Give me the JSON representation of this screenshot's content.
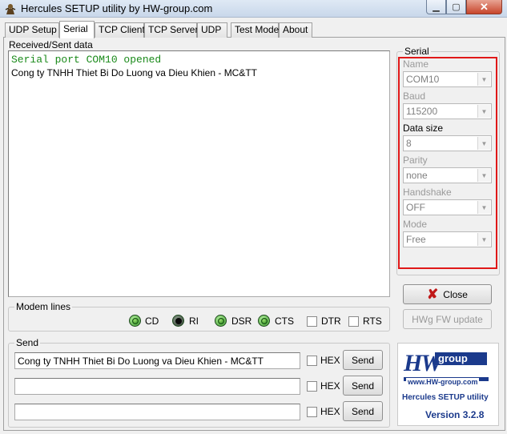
{
  "window": {
    "title": "Hercules SETUP utility by HW-group.com",
    "minimize_glyph": "▁",
    "maximize_glyph": "▢",
    "close_glyph": "✕"
  },
  "tabs": [
    {
      "label": "UDP Setup",
      "active": false
    },
    {
      "label": "Serial",
      "active": true
    },
    {
      "label": "TCP Client",
      "active": false
    },
    {
      "label": "TCP Server",
      "active": false
    },
    {
      "label": "UDP",
      "active": false
    },
    {
      "label": "Test Mode",
      "active": false
    },
    {
      "label": "About",
      "active": false
    }
  ],
  "received": {
    "label": "Received/Sent data",
    "lines": [
      "Serial port COM10 opened",
      "Cong ty TNHH Thiet Bi Do Luong va Dieu Khien - MC&TT"
    ]
  },
  "serial": {
    "group_label": "Serial",
    "highlight_color": "#e01818",
    "fields": [
      {
        "label": "Name",
        "value": "COM10",
        "label_enabled": false
      },
      {
        "label": "Baud",
        "value": "115200",
        "label_enabled": false
      },
      {
        "label": "Data size",
        "value": "8",
        "label_enabled": true
      },
      {
        "label": "Parity",
        "value": "none",
        "label_enabled": false
      },
      {
        "label": "Handshake",
        "value": "OFF",
        "label_enabled": false
      },
      {
        "label": "Mode",
        "value": "Free",
        "label_enabled": false
      }
    ],
    "close_label": "Close",
    "close_icon": "x-icon",
    "fw_update_label": "HWg FW update"
  },
  "modem": {
    "group_label": "Modem lines",
    "leds": [
      {
        "label": "CD",
        "state": "on"
      },
      {
        "label": "RI",
        "state": "off"
      },
      {
        "label": "DSR",
        "state": "on"
      },
      {
        "label": "CTS",
        "state": "on"
      }
    ],
    "checkboxes": [
      {
        "label": "DTR",
        "checked": false
      },
      {
        "label": "RTS",
        "checked": false
      }
    ]
  },
  "send": {
    "group_label": "Send",
    "rows": [
      {
        "value": "Cong ty TNHH Thiet Bi Do Luong va Dieu Khien - MC&TT",
        "hex_label": "HEX",
        "hex_checked": false,
        "button_label": "Send"
      },
      {
        "value": "",
        "hex_label": "HEX",
        "hex_checked": false,
        "button_label": "Send"
      },
      {
        "value": "",
        "hex_label": "HEX",
        "hex_checked": false,
        "button_label": "Send"
      }
    ]
  },
  "logo": {
    "hw": "HW",
    "group": "group",
    "url": "www.HW-group.com",
    "product": "Hercules SETUP utility",
    "version": "Version  3.2.8",
    "brand_color": "#1b3a8c"
  }
}
